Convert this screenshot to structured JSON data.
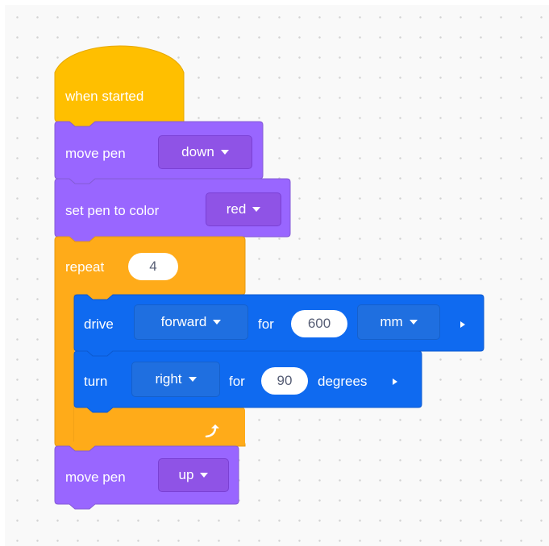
{
  "colors": {
    "events": "#ffbf00",
    "control": "#ffab19",
    "looks": "#9966ff",
    "motion": "#0f6af0"
  },
  "blocks": {
    "when_started": {
      "label": "when started"
    },
    "pen_down": {
      "label": "move pen",
      "value": "down"
    },
    "pen_color": {
      "label": "set pen to color",
      "value": "red"
    },
    "repeat": {
      "label": "repeat",
      "count": "4",
      "loop_icon": "loop-arrow-icon"
    },
    "drive": {
      "label": "drive",
      "direction": "forward",
      "for_label": "for",
      "distance": "600",
      "unit": "mm"
    },
    "turn": {
      "label": "turn",
      "direction": "right",
      "for_label": "for",
      "angle": "90",
      "unit_label": "degrees"
    },
    "pen_up": {
      "label": "move pen",
      "value": "up"
    }
  }
}
